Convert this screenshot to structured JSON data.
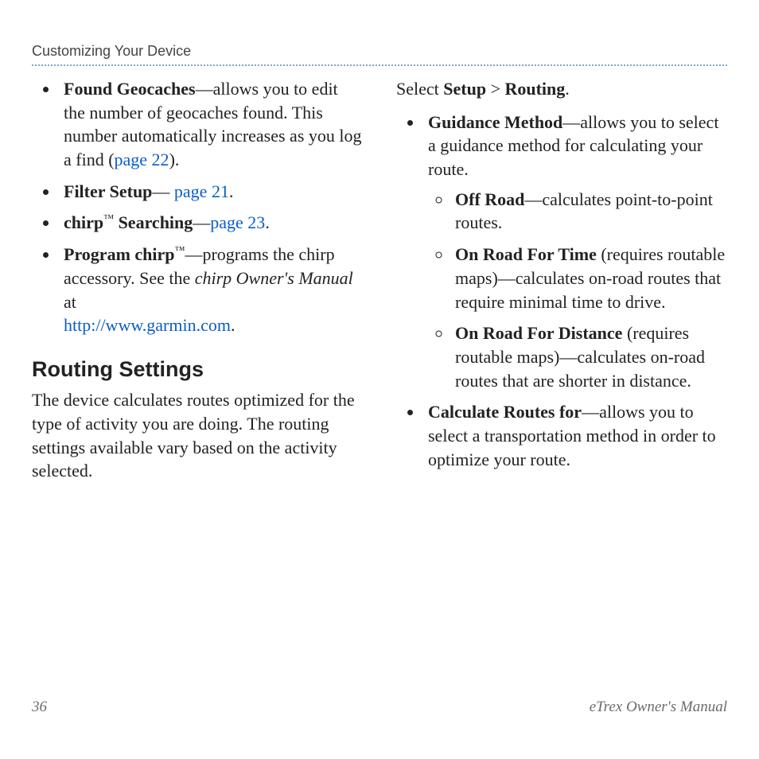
{
  "header": {
    "running_head": "Customizing Your Device"
  },
  "col1": {
    "items": {
      "0": {
        "title": "Found Geocaches",
        "desc1": "—allows you to edit the number of geocaches found. This number automatically increases as you log a find (",
        "link": "page 22",
        "desc2": ")."
      },
      "1": {
        "title": "Filter Setup",
        "dash": "— ",
        "link": "page 21",
        "period": "."
      },
      "2": {
        "title": "chirp",
        "tm": "™",
        "subtitle": " Searching",
        "dash": "—",
        "link": "page 23",
        "period": "."
      },
      "3": {
        "title": "Program chirp",
        "tm": "™",
        "desc1": "—programs the chirp accessory. See the ",
        "italic": "chirp Owner's Manual",
        "desc2": " at ",
        "link": "http://www.garmin.com",
        "period": "."
      }
    },
    "heading": "Routing Settings",
    "para": "The device calculates routes optimized for the type of activity you are doing. The routing settings available vary based on the activity selected."
  },
  "col2": {
    "select_pre": "Select ",
    "select_setup": "Setup",
    "select_gt": " > ",
    "select_routing": "Routing",
    "select_period": ".",
    "items": {
      "0": {
        "title": "Guidance Method",
        "desc": "—allows you to select a guidance method for calculating your route.",
        "sub": {
          "0": {
            "title": "Off Road",
            "desc": "—calculates point-to-point routes."
          },
          "1": {
            "title": "On Road For Time",
            "desc": " (requires routable maps)—calculates on-road routes that require minimal time to drive."
          },
          "2": {
            "title": "On Road For Distance",
            "desc": " (requires routable maps)—calculates on-road routes that are shorter in distance."
          }
        }
      },
      "1": {
        "title": "Calculate Routes for",
        "desc": "—allows you to select a transportation method in order to optimize your route."
      }
    }
  },
  "footer": {
    "page": "36",
    "doc": "eTrex Owner's Manual"
  }
}
